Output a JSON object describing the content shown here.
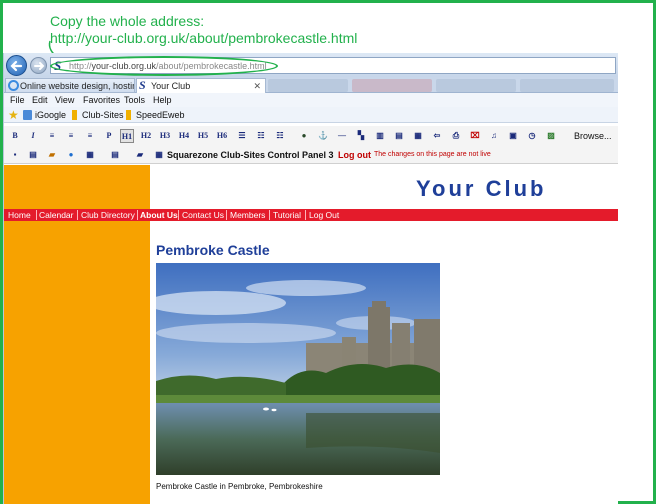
{
  "annotation": {
    "line1": "Copy the whole address:",
    "line2": "http://your-club.org.uk/about/pembrokecastle.html"
  },
  "browser": {
    "url_prefix": "http://",
    "url_host": "your-club.org.uk",
    "url_path": "/about/pembrokecastle.html",
    "tabs": [
      {
        "label": "Online website design, hosting..."
      },
      {
        "label": "Your Club",
        "close": "✕"
      }
    ],
    "menu": [
      "File",
      "Edit",
      "View",
      "Favorites",
      "Tools",
      "Help"
    ],
    "favorites": [
      "iGoogle",
      "Club-Sites",
      "SpeedEweb"
    ]
  },
  "toolbar": {
    "bold": "B",
    "italic": "I",
    "paragraph": "P",
    "headings": [
      "H1",
      "H2",
      "H3",
      "H4",
      "H5",
      "H6"
    ],
    "browse": "Browse...",
    "panel_title": "Squarezone Club-Sites Control Panel 3",
    "logout": "Log out",
    "notice": "The changes on this page are not live"
  },
  "site": {
    "title": "Your Club",
    "nav": [
      {
        "label": "Home",
        "active": false
      },
      {
        "label": "Calendar",
        "active": false
      },
      {
        "label": "Club Directory",
        "active": false
      },
      {
        "label": "About Us",
        "active": true
      },
      {
        "label": "Contact Us",
        "active": false
      },
      {
        "label": "Members",
        "active": false
      },
      {
        "label": "Tutorial",
        "active": false
      },
      {
        "label": "Log Out",
        "active": false
      }
    ],
    "page_title": "Pembroke Castle",
    "caption": "Pembroke Castle in Pembroke, Pembrokeshire"
  },
  "colors": {
    "annotation": "#22b14c",
    "sidebar": "#f7a200",
    "nav": "#e41b2b",
    "heading": "#1f3f99"
  }
}
